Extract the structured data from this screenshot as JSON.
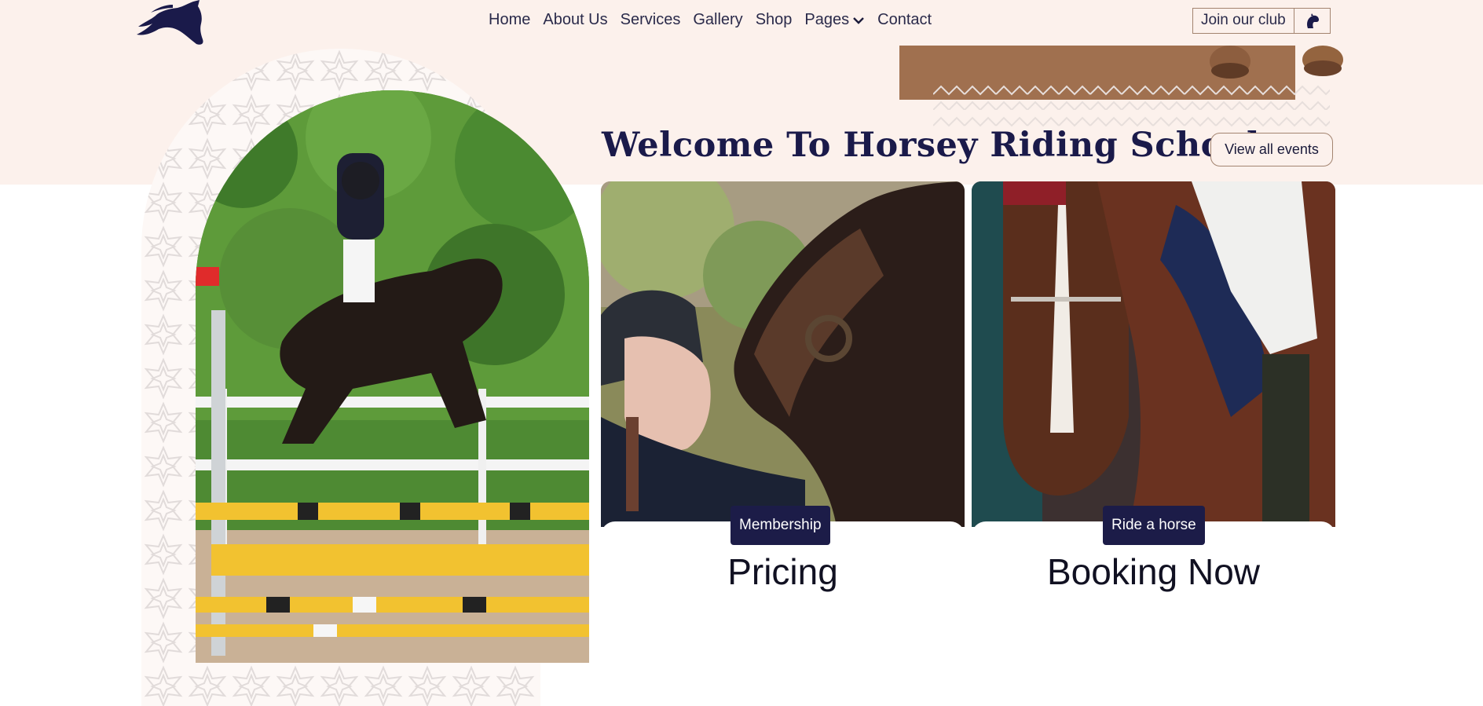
{
  "header": {
    "logo_icon": "horse-head-logo-icon",
    "nav": [
      {
        "label": "Home"
      },
      {
        "label": "About Us"
      },
      {
        "label": "Services"
      },
      {
        "label": "Gallery"
      },
      {
        "label": "Shop"
      },
      {
        "label": "Pages",
        "has_dropdown": true
      },
      {
        "label": "Contact"
      }
    ],
    "join_label": "Join our club",
    "join_icon": "horse-head-icon"
  },
  "hero": {
    "title": "Welcome To Horsey Riding School",
    "events_label": "View all events",
    "left_image": "rider-jumping-horse-photo"
  },
  "cards": [
    {
      "badge": "Membership",
      "title": "Pricing",
      "image": "rider-kissing-horse-photo"
    },
    {
      "badge": "Ride a horse",
      "title": "Booking Now",
      "image": "horse-close-up-photo"
    }
  ],
  "colors": {
    "band": "#fcf1ec",
    "navy": "#1c1c48",
    "brown": "#a0704f",
    "border": "#a38470"
  }
}
